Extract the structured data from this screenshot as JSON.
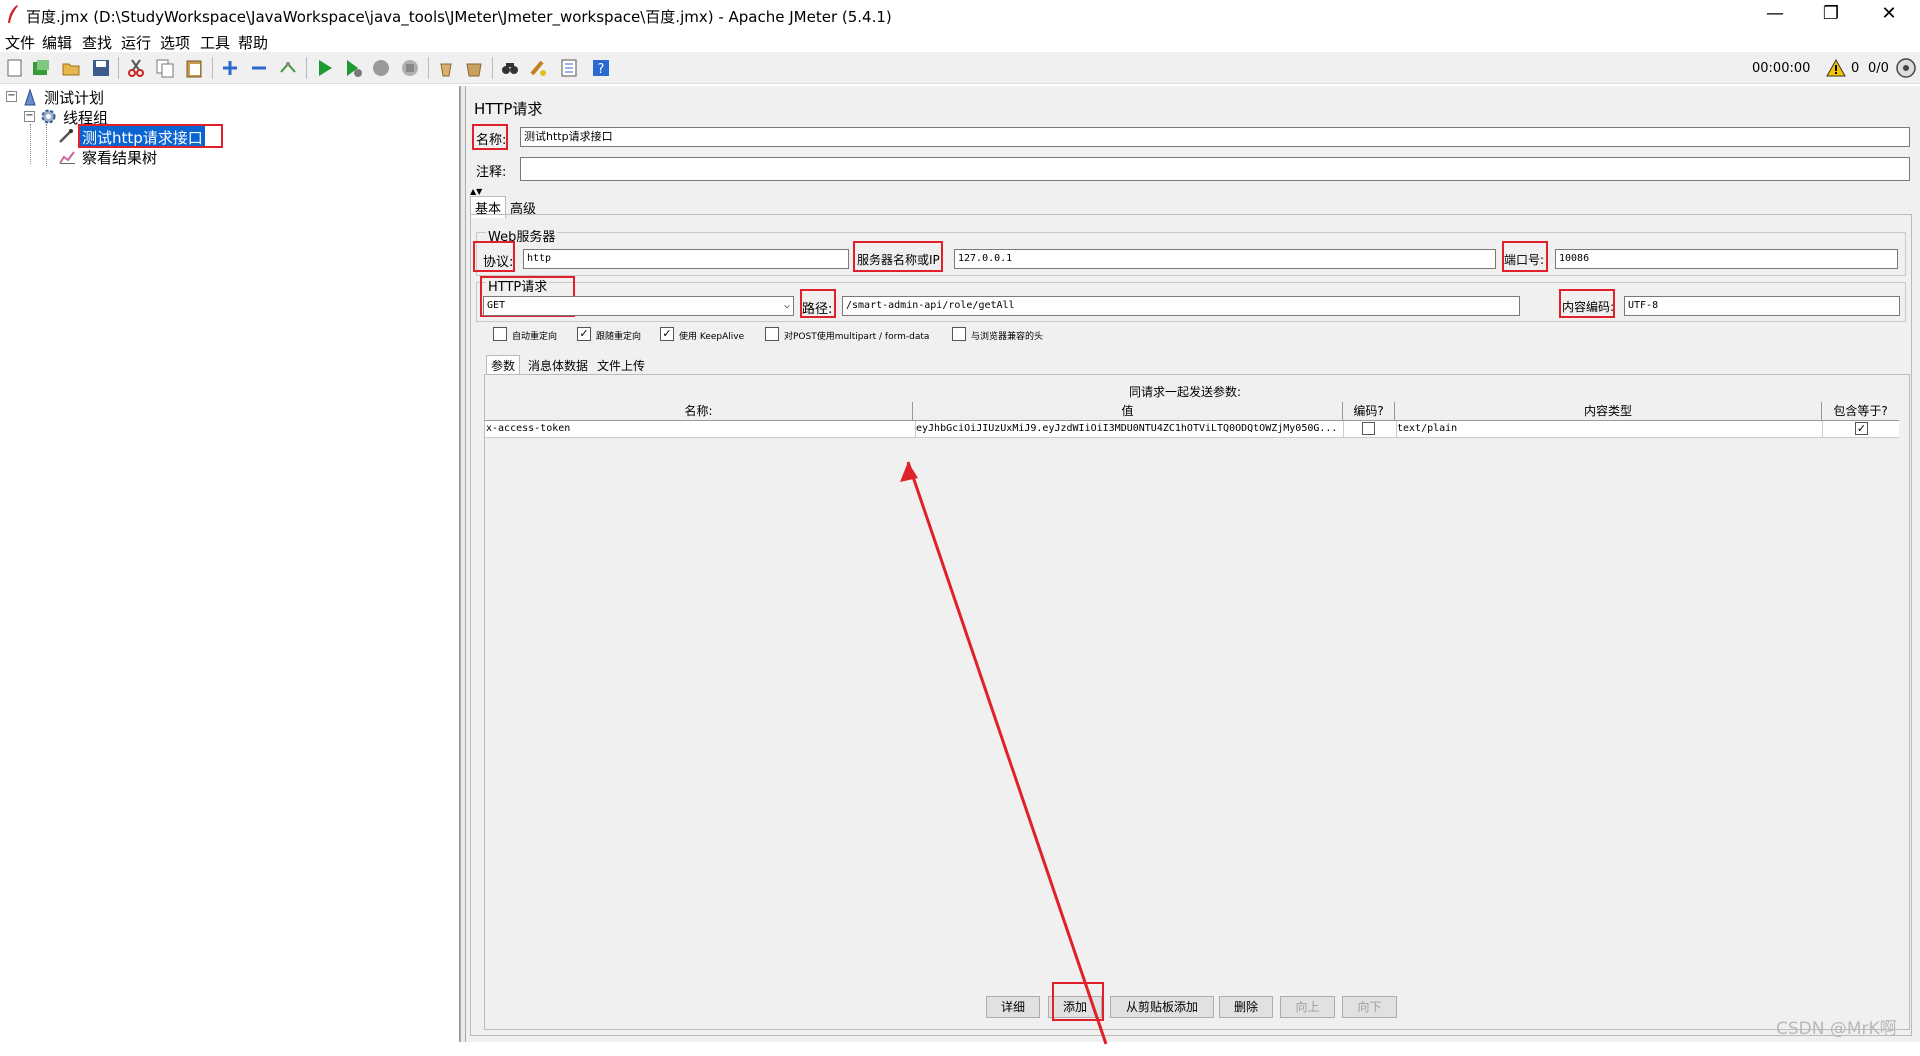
{
  "window": {
    "title": "百度.jmx (D:\\StudyWorkspace\\JavaWorkspace\\java_tools\\JMeter\\Jmeter_workspace\\百度.jmx) - Apache JMeter (5.4.1)",
    "minimize": "—",
    "restore": "❐",
    "close": "✕"
  },
  "menu": [
    "文件",
    "编辑",
    "查找",
    "运行",
    "选项",
    "工具",
    "帮助"
  ],
  "toolbar": {
    "timer": "00:00:00",
    "warnings": "0",
    "threads": "0/0"
  },
  "tree": {
    "plan": "测试计划",
    "thread_group": "线程组",
    "http_sampler": "测试http请求接口",
    "listener": "察看结果树"
  },
  "panel": {
    "title": "HTTP请求",
    "name_label": "名称:",
    "name_value": "测试http请求接口",
    "comment_label": "注释:",
    "comment_value": "",
    "tab_basic": "基本",
    "tab_advanced": "高级",
    "web_server_group": "Web服务器",
    "protocol_label": "协议:",
    "protocol_value": "http",
    "server_label": "服务器名称或IP:",
    "server_value": "127.0.0.1",
    "port_label": "端口号:",
    "port_value": "10086",
    "http_group": "HTTP请求",
    "method_value": "GET",
    "path_label": "路径:",
    "path_value": "/smart-admin-api/role/getAll",
    "encoding_label": "内容编码:",
    "encoding_value": "UTF-8",
    "checkboxes": [
      {
        "label": "自动重定向",
        "checked": false
      },
      {
        "label": "跟随重定向",
        "checked": true
      },
      {
        "label": "使用 KeepAlive",
        "checked": true
      },
      {
        "label": "对POST使用multipart / form-data",
        "checked": false
      },
      {
        "label": "与浏览器兼容的头",
        "checked": false
      }
    ],
    "subtabs": [
      "参数",
      "消息体数据",
      "文件上传"
    ],
    "params_caption": "同请求一起发送参数:",
    "columns": [
      "名称:",
      "值",
      "编码?",
      "内容类型",
      "包含等于?"
    ],
    "rows": [
      {
        "name": "x-access-token",
        "value": "eyJhbGciOiJIUzUxMiJ9.eyJzdWIiOiI3MDU0NTU4ZC1hOTViLTQ0ODQtOWZjMy050G...",
        "encode": false,
        "content_type": "text/plain",
        "include_equals": true
      }
    ],
    "buttons": {
      "detail": "详细",
      "add": "添加",
      "add_clipboard": "从剪贴板添加",
      "delete": "删除",
      "up": "向上",
      "down": "向下"
    }
  },
  "watermark": "CSDN @MrK啊",
  "colors": {
    "annotation_red": "#e0202a",
    "selection_blue": "#0a64d2"
  }
}
